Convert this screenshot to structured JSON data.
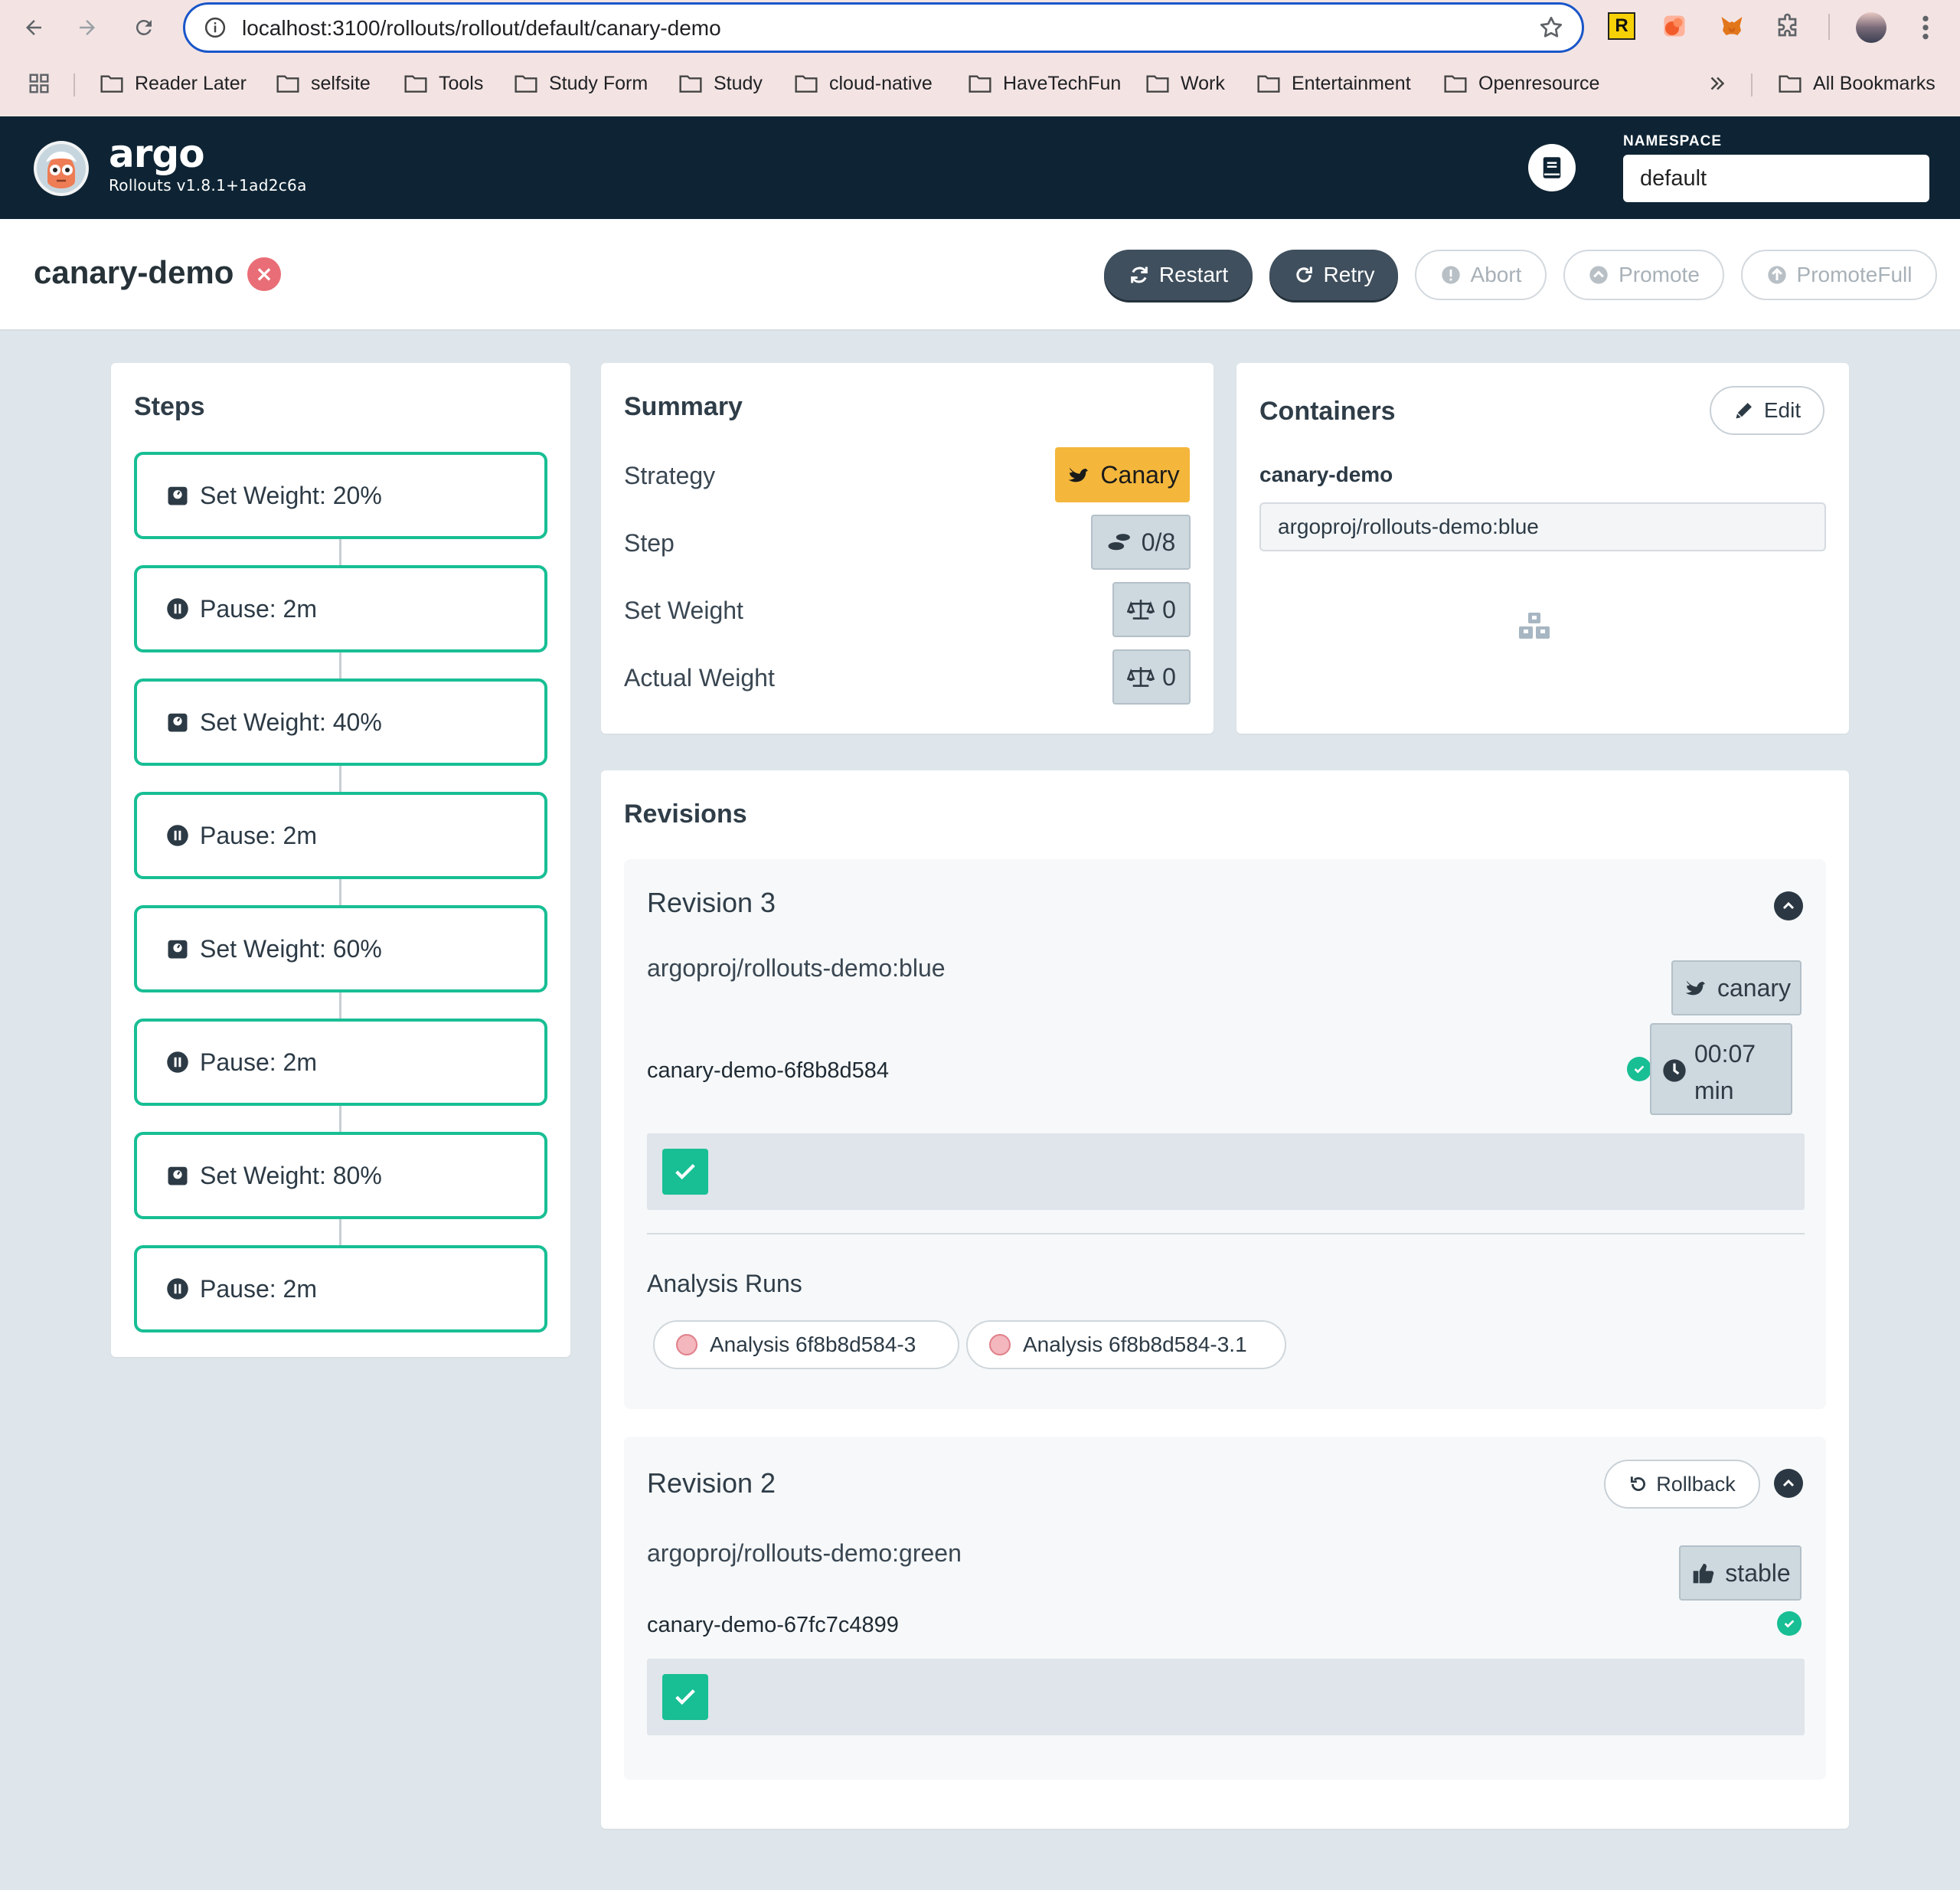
{
  "browser": {
    "url": "localhost:3100/rollouts/rollout/default/canary-demo",
    "bookmarks": [
      "Reader Later",
      "selfsite",
      "Tools",
      "Study Form",
      "Study",
      "cloud-native",
      "HaveTechFun",
      "Work",
      "Entertainment",
      "Openresource"
    ],
    "all_bookmarks": "All Bookmarks",
    "ext_r_label": "R"
  },
  "header": {
    "brand": "argo",
    "version": "Rollouts v1.8.1+1ad2c6a",
    "namespace_label": "NAMESPACE",
    "namespace_value": "default"
  },
  "rollout": {
    "name": "canary-demo",
    "status_icon": "×",
    "actions": {
      "restart": "Restart",
      "retry": "Retry",
      "abort": "Abort",
      "promote": "Promote",
      "promote_full": "PromoteFull"
    }
  },
  "steps": {
    "title": "Steps",
    "items": [
      {
        "label": "Set Weight: 20%"
      },
      {
        "label": "Pause: 2m"
      },
      {
        "label": "Set Weight: 40%"
      },
      {
        "label": "Pause: 2m"
      },
      {
        "label": "Set Weight: 60%"
      },
      {
        "label": "Pause: 2m"
      },
      {
        "label": "Set Weight: 80%"
      },
      {
        "label": "Pause: 2m"
      }
    ]
  },
  "summary": {
    "title": "Summary",
    "strategy_label": "Strategy",
    "strategy_value": "Canary",
    "step_label": "Step",
    "step_value": "0/8",
    "set_weight_label": "Set Weight",
    "set_weight_value": "0",
    "actual_weight_label": "Actual Weight",
    "actual_weight_value": "0"
  },
  "containers": {
    "title": "Containers",
    "edit_label": "Edit",
    "name": "canary-demo",
    "image": "argoproj/rollouts-demo:blue"
  },
  "revisions": {
    "title": "Revisions",
    "items": [
      {
        "title": "Revision 3",
        "image": "argoproj/rollouts-demo:blue",
        "badge": "canary",
        "replicaset": "canary-demo-6f8b8d584",
        "time_value": "00:07",
        "time_unit": "min",
        "analysis_title": "Analysis Runs",
        "analysis_runs": [
          "Analysis 6f8b8d584-3",
          "Analysis 6f8b8d584-3.1"
        ]
      },
      {
        "title": "Revision 2",
        "image": "argoproj/rollouts-demo:green",
        "badge": "stable",
        "replicaset": "canary-demo-67fc7c4899",
        "rollback_label": "Rollback"
      }
    ]
  },
  "colors": {
    "header_bg": "#0e2434",
    "step_border": "#18be94",
    "canary": "#f4b73c",
    "healthy": "#18be94",
    "degraded": "#e96d76",
    "page_bg": "#dee6eb"
  }
}
